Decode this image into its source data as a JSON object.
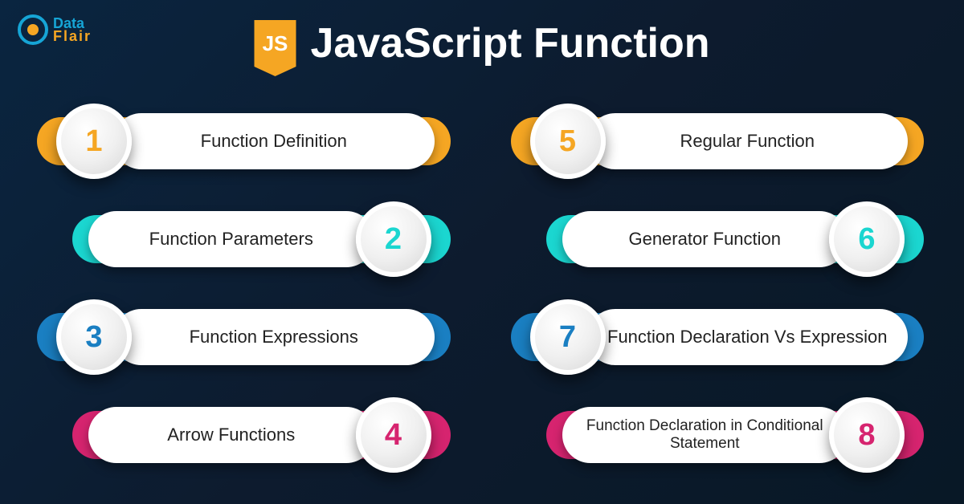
{
  "brand": {
    "top": "Data",
    "bottom": "Flair"
  },
  "header": {
    "badge": "JS",
    "title": "JavaScript Function"
  },
  "items": [
    {
      "num": "1",
      "label": "Function Definition",
      "color": "orange",
      "side": "left"
    },
    {
      "num": "5",
      "label": "Regular Function",
      "color": "orange",
      "side": "left"
    },
    {
      "num": "2",
      "label": "Function Parameters",
      "color": "cyan",
      "side": "right"
    },
    {
      "num": "6",
      "label": "Generator Function",
      "color": "cyan",
      "side": "right"
    },
    {
      "num": "3",
      "label": "Function Expressions",
      "color": "blue",
      "side": "left"
    },
    {
      "num": "7",
      "label": "Function Declaration Vs Expression",
      "color": "blue",
      "side": "left"
    },
    {
      "num": "4",
      "label": "Arrow Functions",
      "color": "pink",
      "side": "right"
    },
    {
      "num": "8",
      "label": "Function Declaration in Conditional Statement",
      "color": "pink",
      "side": "right"
    }
  ]
}
